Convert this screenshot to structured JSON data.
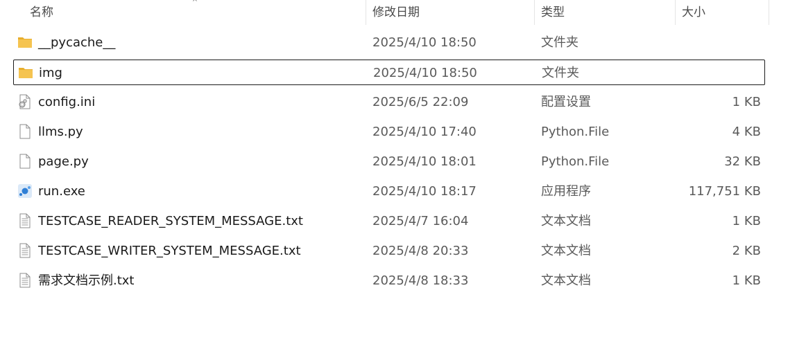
{
  "columns": {
    "name": "名称",
    "modified": "修改日期",
    "type": "类型",
    "size": "大小",
    "sort_glyph": "^"
  },
  "files": [
    {
      "name": "__pycache__",
      "modified": "2025/4/10 18:50",
      "type": "文件夹",
      "size": "",
      "icon": "folder-icon",
      "selected": false
    },
    {
      "name": "img",
      "modified": "2025/4/10 18:50",
      "type": "文件夹",
      "size": "",
      "icon": "folder-icon",
      "selected": true
    },
    {
      "name": "config.ini",
      "modified": "2025/6/5 22:09",
      "type": "配置设置",
      "size": "1 KB",
      "icon": "config-file-icon",
      "selected": false
    },
    {
      "name": "llms.py",
      "modified": "2025/4/10 17:40",
      "type": "Python.File",
      "size": "4 KB",
      "icon": "blank-file-icon",
      "selected": false
    },
    {
      "name": "page.py",
      "modified": "2025/4/10 18:01",
      "type": "Python.File",
      "size": "32 KB",
      "icon": "blank-file-icon",
      "selected": false
    },
    {
      "name": "run.exe",
      "modified": "2025/4/10 18:17",
      "type": "应用程序",
      "size": "117,751 KB",
      "icon": "exe-icon",
      "selected": false
    },
    {
      "name": "TESTCASE_READER_SYSTEM_MESSAGE.txt",
      "modified": "2025/4/7 16:04",
      "type": "文本文档",
      "size": "1 KB",
      "icon": "text-file-icon",
      "selected": false
    },
    {
      "name": "TESTCASE_WRITER_SYSTEM_MESSAGE.txt",
      "modified": "2025/4/8 20:33",
      "type": "文本文档",
      "size": "2 KB",
      "icon": "text-file-icon",
      "selected": false
    },
    {
      "name": "需求文档示例.txt",
      "modified": "2025/4/8 18:33",
      "type": "文本文档",
      "size": "1 KB",
      "icon": "text-file-icon",
      "selected": false
    }
  ],
  "colors": {
    "folder": "#f5c451",
    "selection_border": "#1a1a1a",
    "exe_blue": "#2f7fd6"
  }
}
